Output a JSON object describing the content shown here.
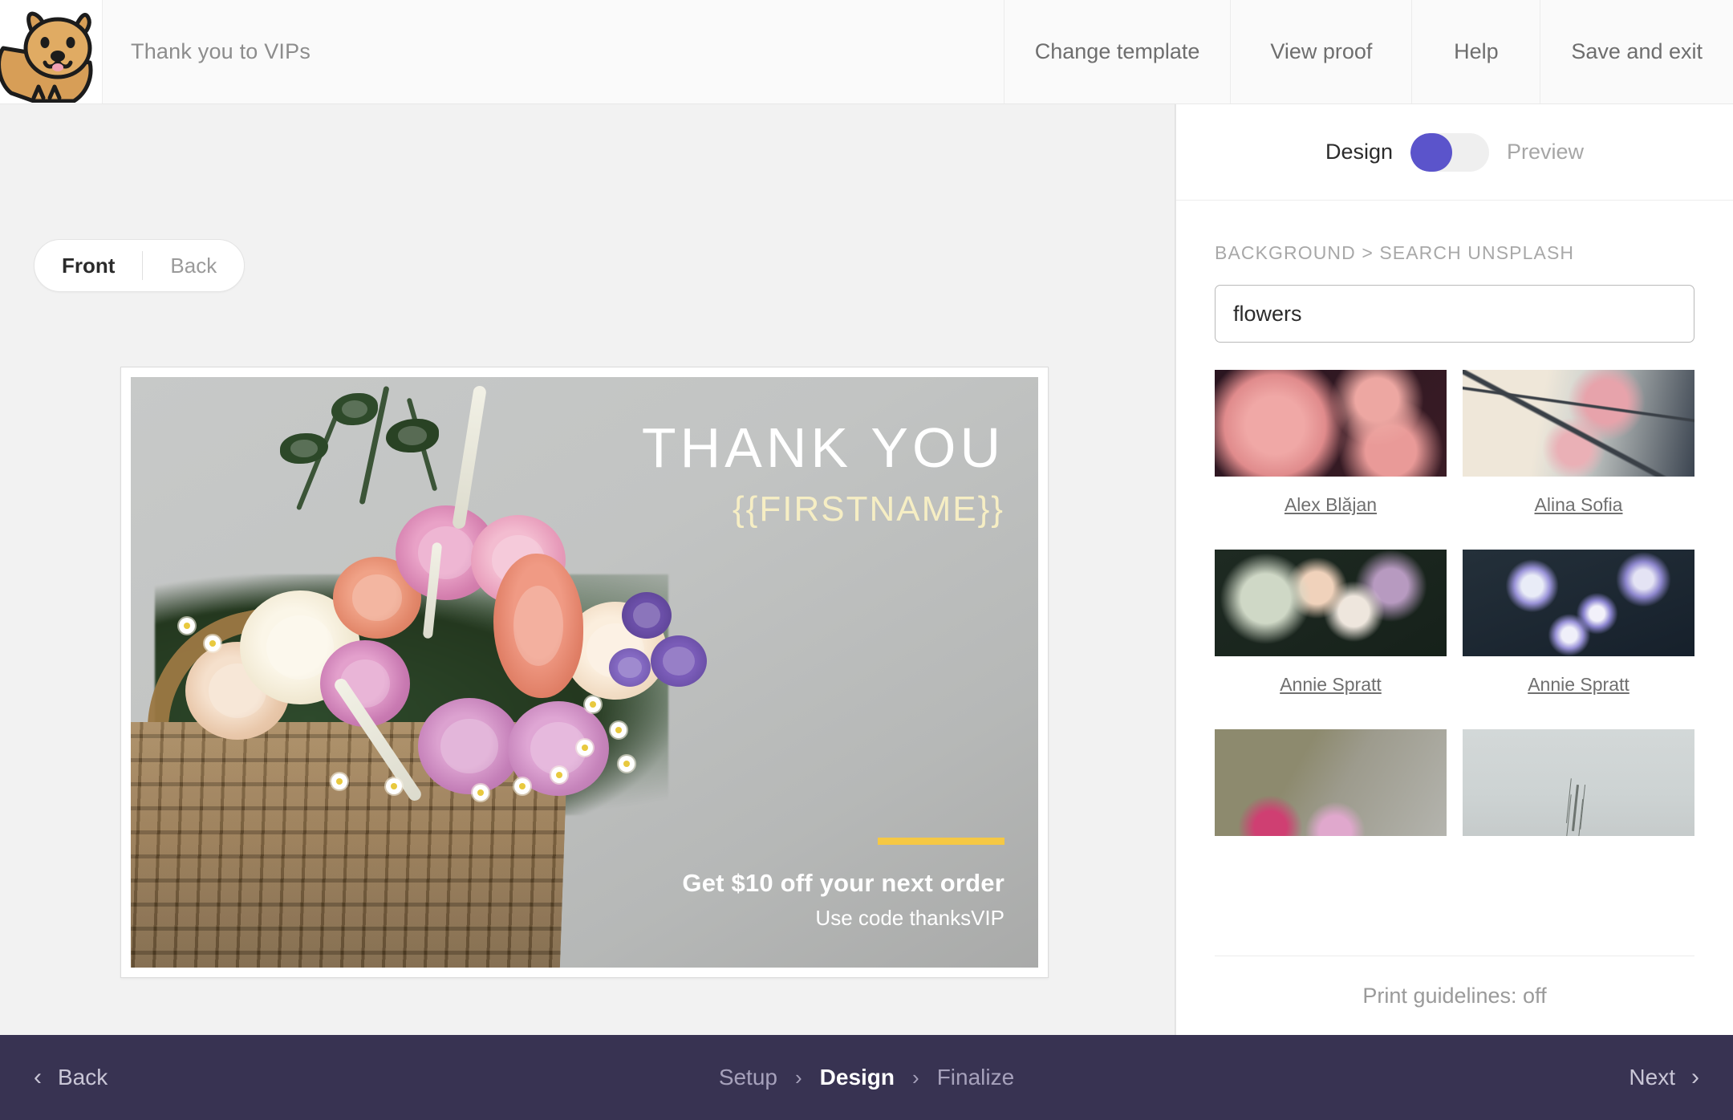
{
  "topbar": {
    "logo_icon": "quokka-mascot-logo",
    "document_title": "Thank you to VIPs",
    "nav": [
      {
        "label": "Change template",
        "name": "change-template"
      },
      {
        "label": "View proof",
        "name": "view-proof"
      },
      {
        "label": "Help",
        "name": "help"
      },
      {
        "label": "Save and exit",
        "name": "save-and-exit"
      }
    ]
  },
  "canvas": {
    "side_toggle": {
      "front": "Front",
      "back": "Back",
      "active": "Front"
    },
    "card": {
      "headline": "THANK YOU",
      "merge_tag": "{{FIRSTNAME}}",
      "offer_headline": "Get $10 off your next order",
      "offer_subline": "Use code thanksVIP",
      "accent_bar_color": "#f5c844",
      "merge_tag_color": "#f6eec4",
      "image_description": "flower basket with roses and daisies on grey background"
    }
  },
  "panel": {
    "mode_toggle": {
      "left_label": "Design",
      "right_label": "Preview",
      "active": "Design",
      "accent_color": "#5b54cb"
    },
    "breadcrumb": "BACKGROUND > SEARCH UNSPLASH",
    "search": {
      "value": "flowers",
      "placeholder": "Search Unsplash"
    },
    "results": [
      {
        "credit": "Alex Blăjan",
        "art": "t1"
      },
      {
        "credit": "Alina Sofia",
        "art": "t2"
      },
      {
        "credit": "Annie Spratt",
        "art": "t3"
      },
      {
        "credit": "Annie Spratt",
        "art": "t4"
      },
      {
        "credit": "",
        "art": "t5"
      },
      {
        "credit": "",
        "art": "t6"
      }
    ],
    "print_guidelines": "Print guidelines: off"
  },
  "footer": {
    "back_label": "Back",
    "next_label": "Next",
    "back_icon": "chevron-left-icon",
    "next_icon": "chevron-right-icon",
    "steps": [
      {
        "label": "Setup",
        "current": false
      },
      {
        "label": "Design",
        "current": true
      },
      {
        "label": "Finalize",
        "current": false
      }
    ],
    "separator": "›",
    "background_color": "#383352"
  }
}
